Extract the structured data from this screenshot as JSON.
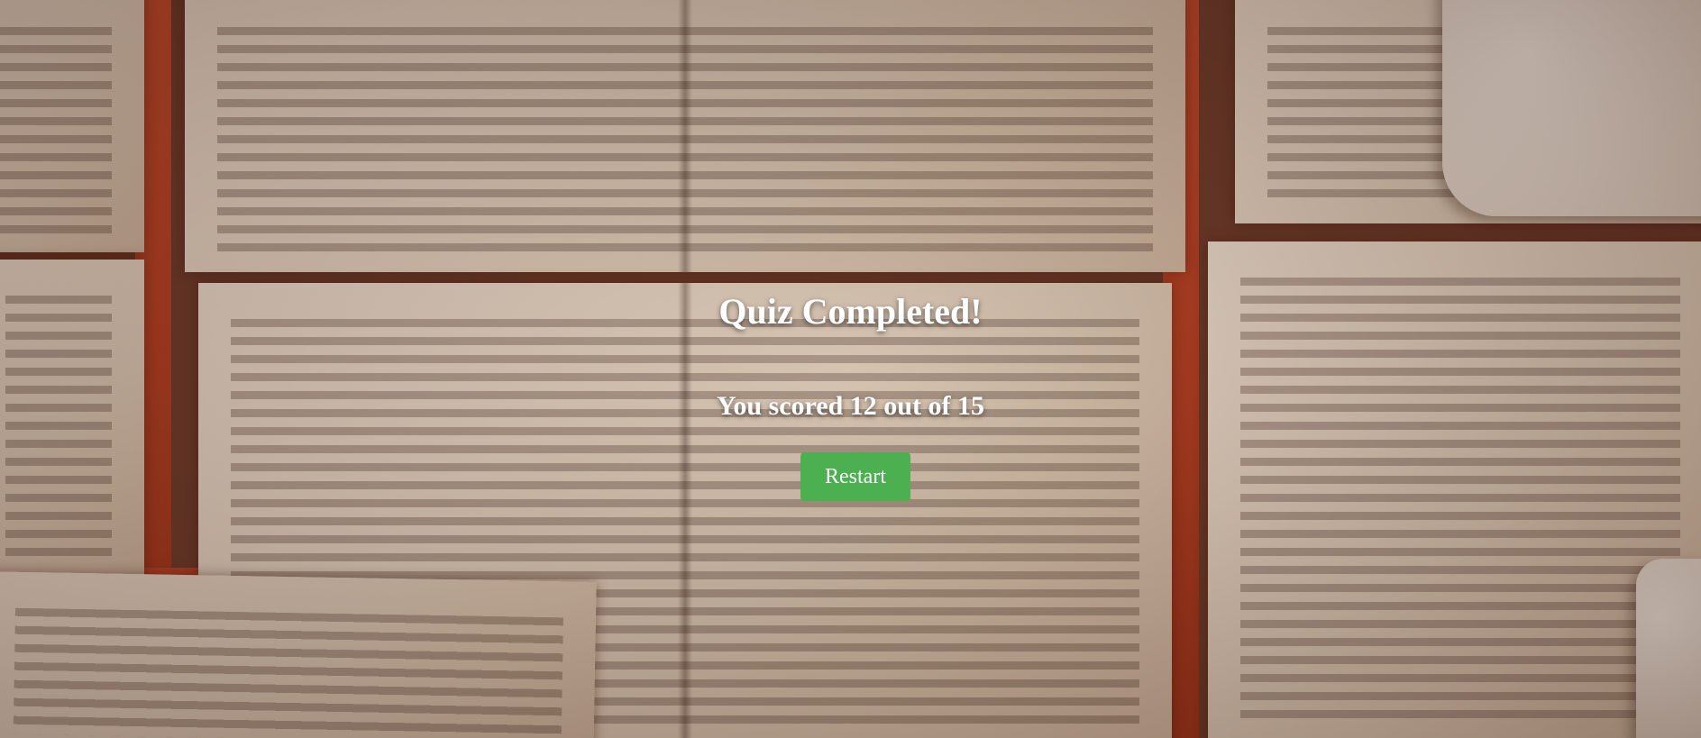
{
  "quiz_result": {
    "title": "Quiz Completed!",
    "score_text": "You scored 12 out of 15",
    "restart_label": "Restart",
    "accent_color": "#4caf50"
  }
}
